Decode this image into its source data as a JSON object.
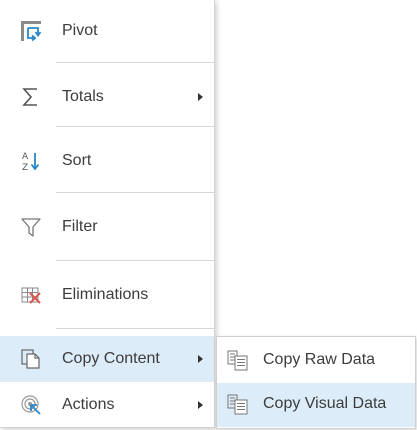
{
  "menu": {
    "items": [
      {
        "label": "Pivot",
        "icon": "pivot-icon",
        "has_submenu": false
      },
      {
        "label": "Totals",
        "icon": "sigma-icon",
        "has_submenu": true
      },
      {
        "label": "Sort",
        "icon": "sort-az-icon",
        "has_submenu": false
      },
      {
        "label": "Filter",
        "icon": "filter-funnel-icon",
        "has_submenu": false
      },
      {
        "label": "Eliminations",
        "icon": "eliminations-icon",
        "has_submenu": false
      },
      {
        "label": "Copy Content",
        "icon": "copy-content-icon",
        "has_submenu": true,
        "highlighted": true
      },
      {
        "label": "Actions",
        "icon": "actions-icon",
        "has_submenu": true
      }
    ]
  },
  "submenu": {
    "items": [
      {
        "label": "Copy Raw Data",
        "icon": "copy-raw-data-icon"
      },
      {
        "label": "Copy Visual Data",
        "icon": "copy-visual-data-icon",
        "highlighted": true
      }
    ]
  },
  "colors": {
    "highlight": "#dcecf8",
    "accent_blue": "#2b86c8",
    "separator": "#d6d6d6",
    "text": "#3c3c3c",
    "elimination_red": "#d9534f"
  }
}
